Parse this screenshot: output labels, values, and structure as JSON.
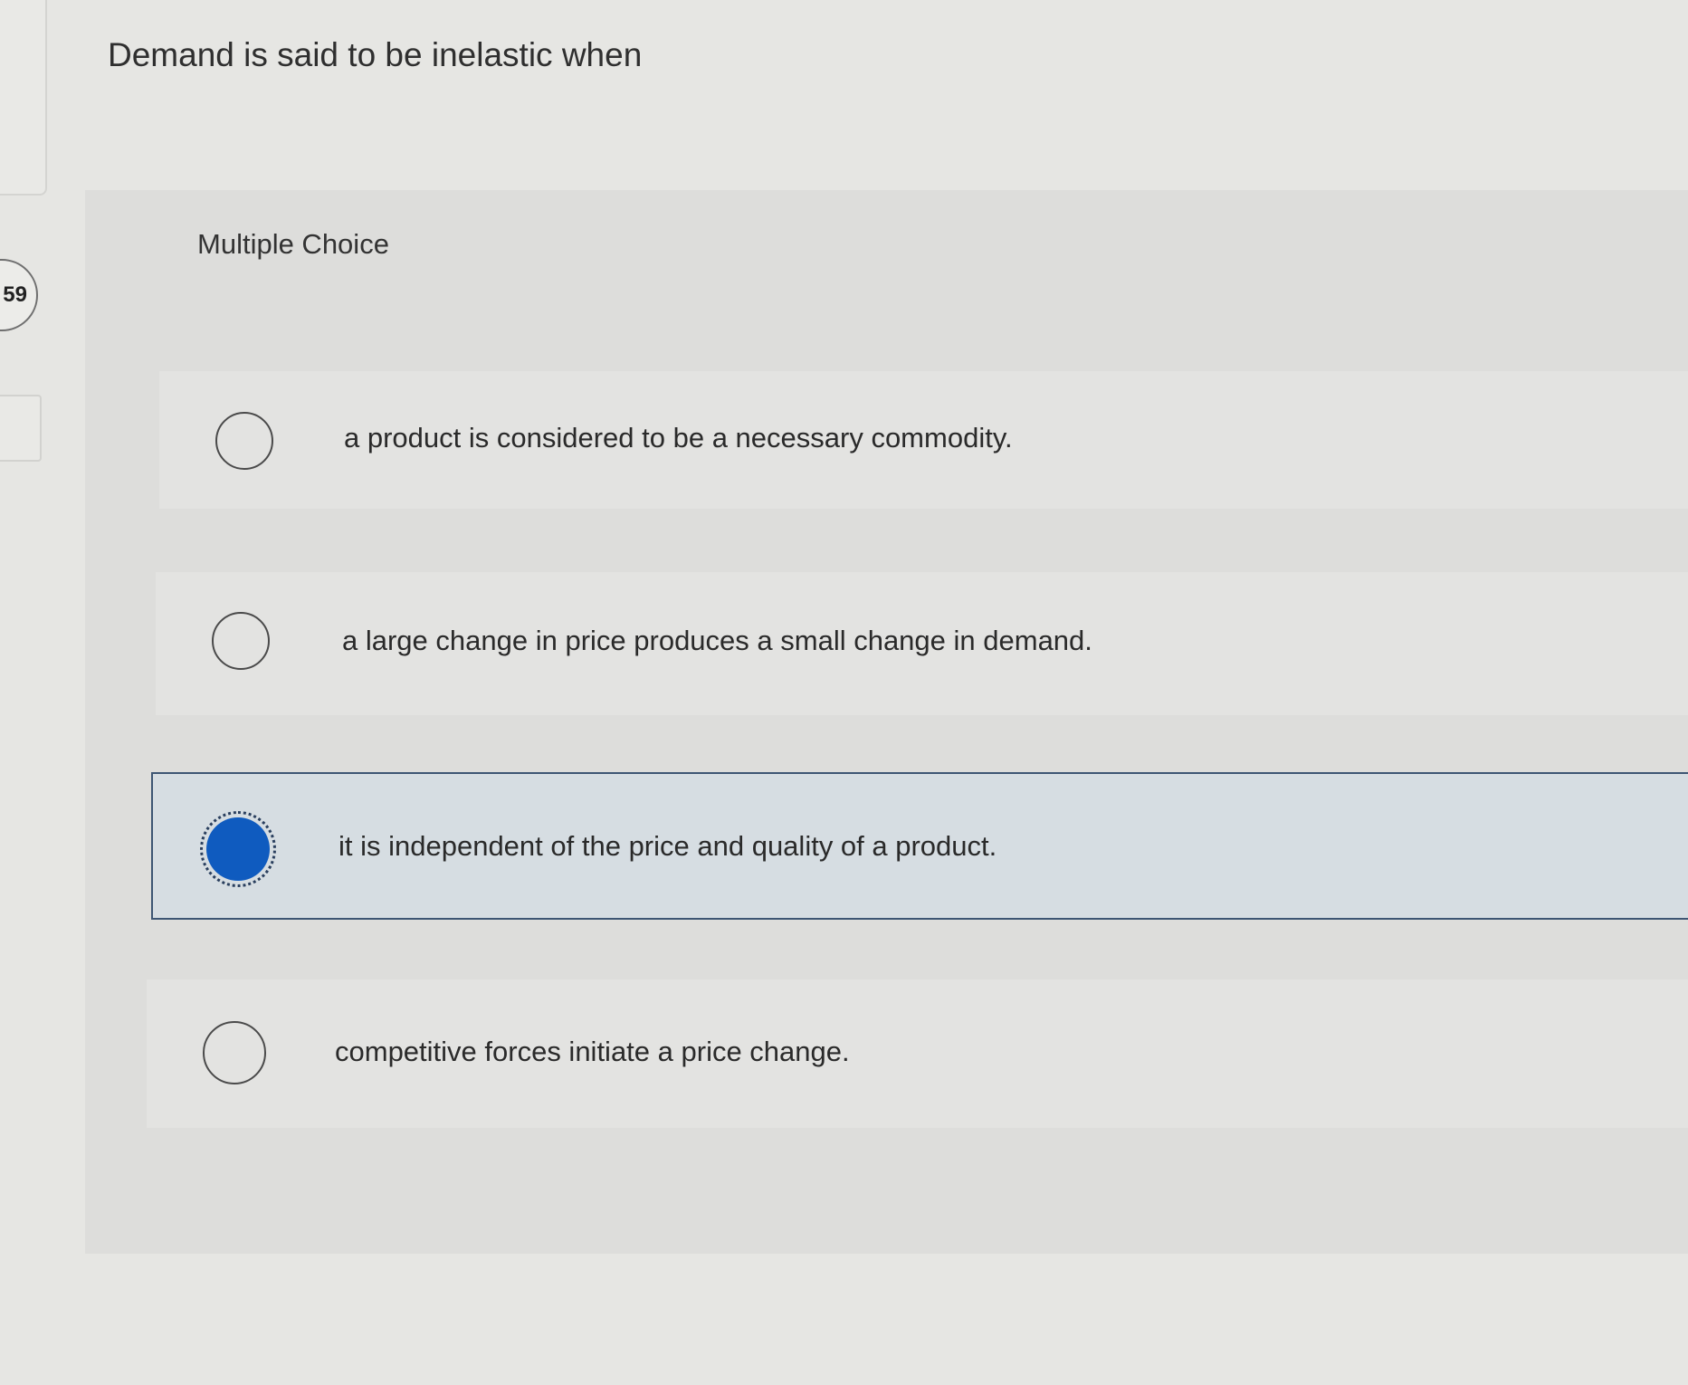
{
  "sidebar": {
    "question_number": "59"
  },
  "question": {
    "text": "Demand is said to be inelastic when"
  },
  "panel": {
    "label": "Multiple Choice"
  },
  "options": [
    {
      "text": "a product is considered to be a necessary commodity.",
      "selected": false
    },
    {
      "text": "a large change in price produces a small change in demand.",
      "selected": false
    },
    {
      "text": "it is independent of the price and quality of a product.",
      "selected": true
    },
    {
      "text": "competitive forces initiate a price change.",
      "selected": false
    }
  ],
  "colors": {
    "selected_radio": "#0f5bbf",
    "selected_border": "#3d5573",
    "selected_background": "#d6dde2"
  }
}
